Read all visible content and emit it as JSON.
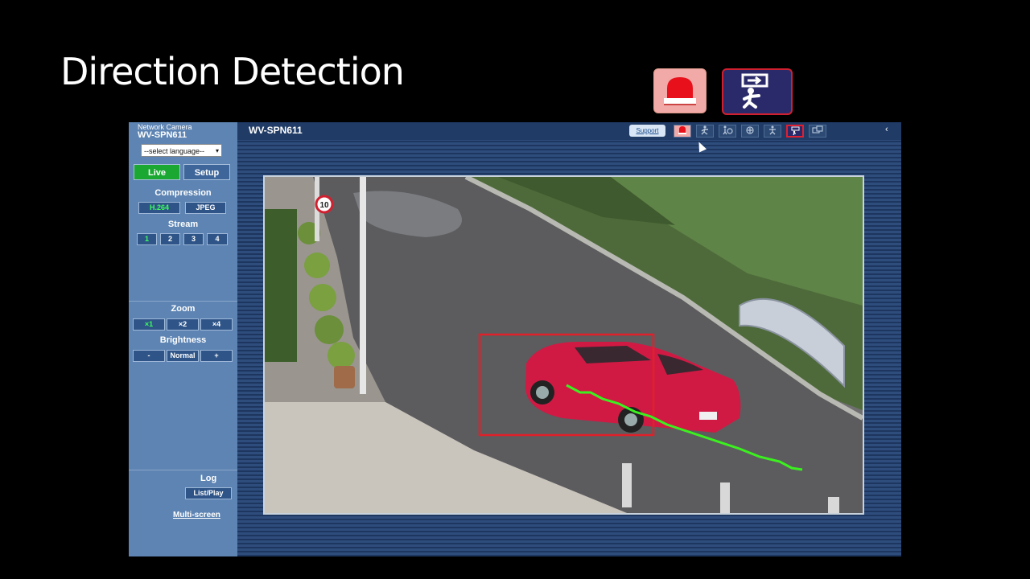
{
  "slide": {
    "title": "Direction Detection"
  },
  "sidebar": {
    "brand_small": "Network Camera",
    "brand_model": "WV-SPN611",
    "language_select": "--select language--",
    "tabs": [
      {
        "label": "Live",
        "active": true
      },
      {
        "label": "Setup",
        "active": false
      }
    ],
    "compression": {
      "title": "Compression",
      "options": [
        "H.264",
        "JPEG"
      ],
      "selected": "H.264"
    },
    "stream": {
      "title": "Stream",
      "options": [
        "1",
        "2",
        "3",
        "4"
      ],
      "selected": "1"
    },
    "zoom": {
      "title": "Zoom",
      "options": [
        "×1",
        "×2",
        "×4"
      ],
      "selected": "×1"
    },
    "brightness": {
      "title": "Brightness",
      "minus": "-",
      "normal": "Normal",
      "plus": "+"
    },
    "log": {
      "title": "Log",
      "button": "List/Play"
    },
    "multiscreen_link": "Multi-screen"
  },
  "topbar": {
    "model": "WV-SPN611",
    "support": "Support",
    "tools": [
      "alarm-icon",
      "intrusion-icon",
      "loitering-icon",
      "object-detection-icon",
      "camera-tamper-icon",
      "direction-detection-icon",
      "scene-change-icon"
    ],
    "selected_tool": "direction-detection-icon",
    "collapse": "‹"
  },
  "video": {
    "speed_sign": "10"
  },
  "colors": {
    "accent_live": "#1aa832",
    "detection_box": "#e0202a",
    "trajectory": "#3cf020",
    "panel": "#5d84b3"
  }
}
